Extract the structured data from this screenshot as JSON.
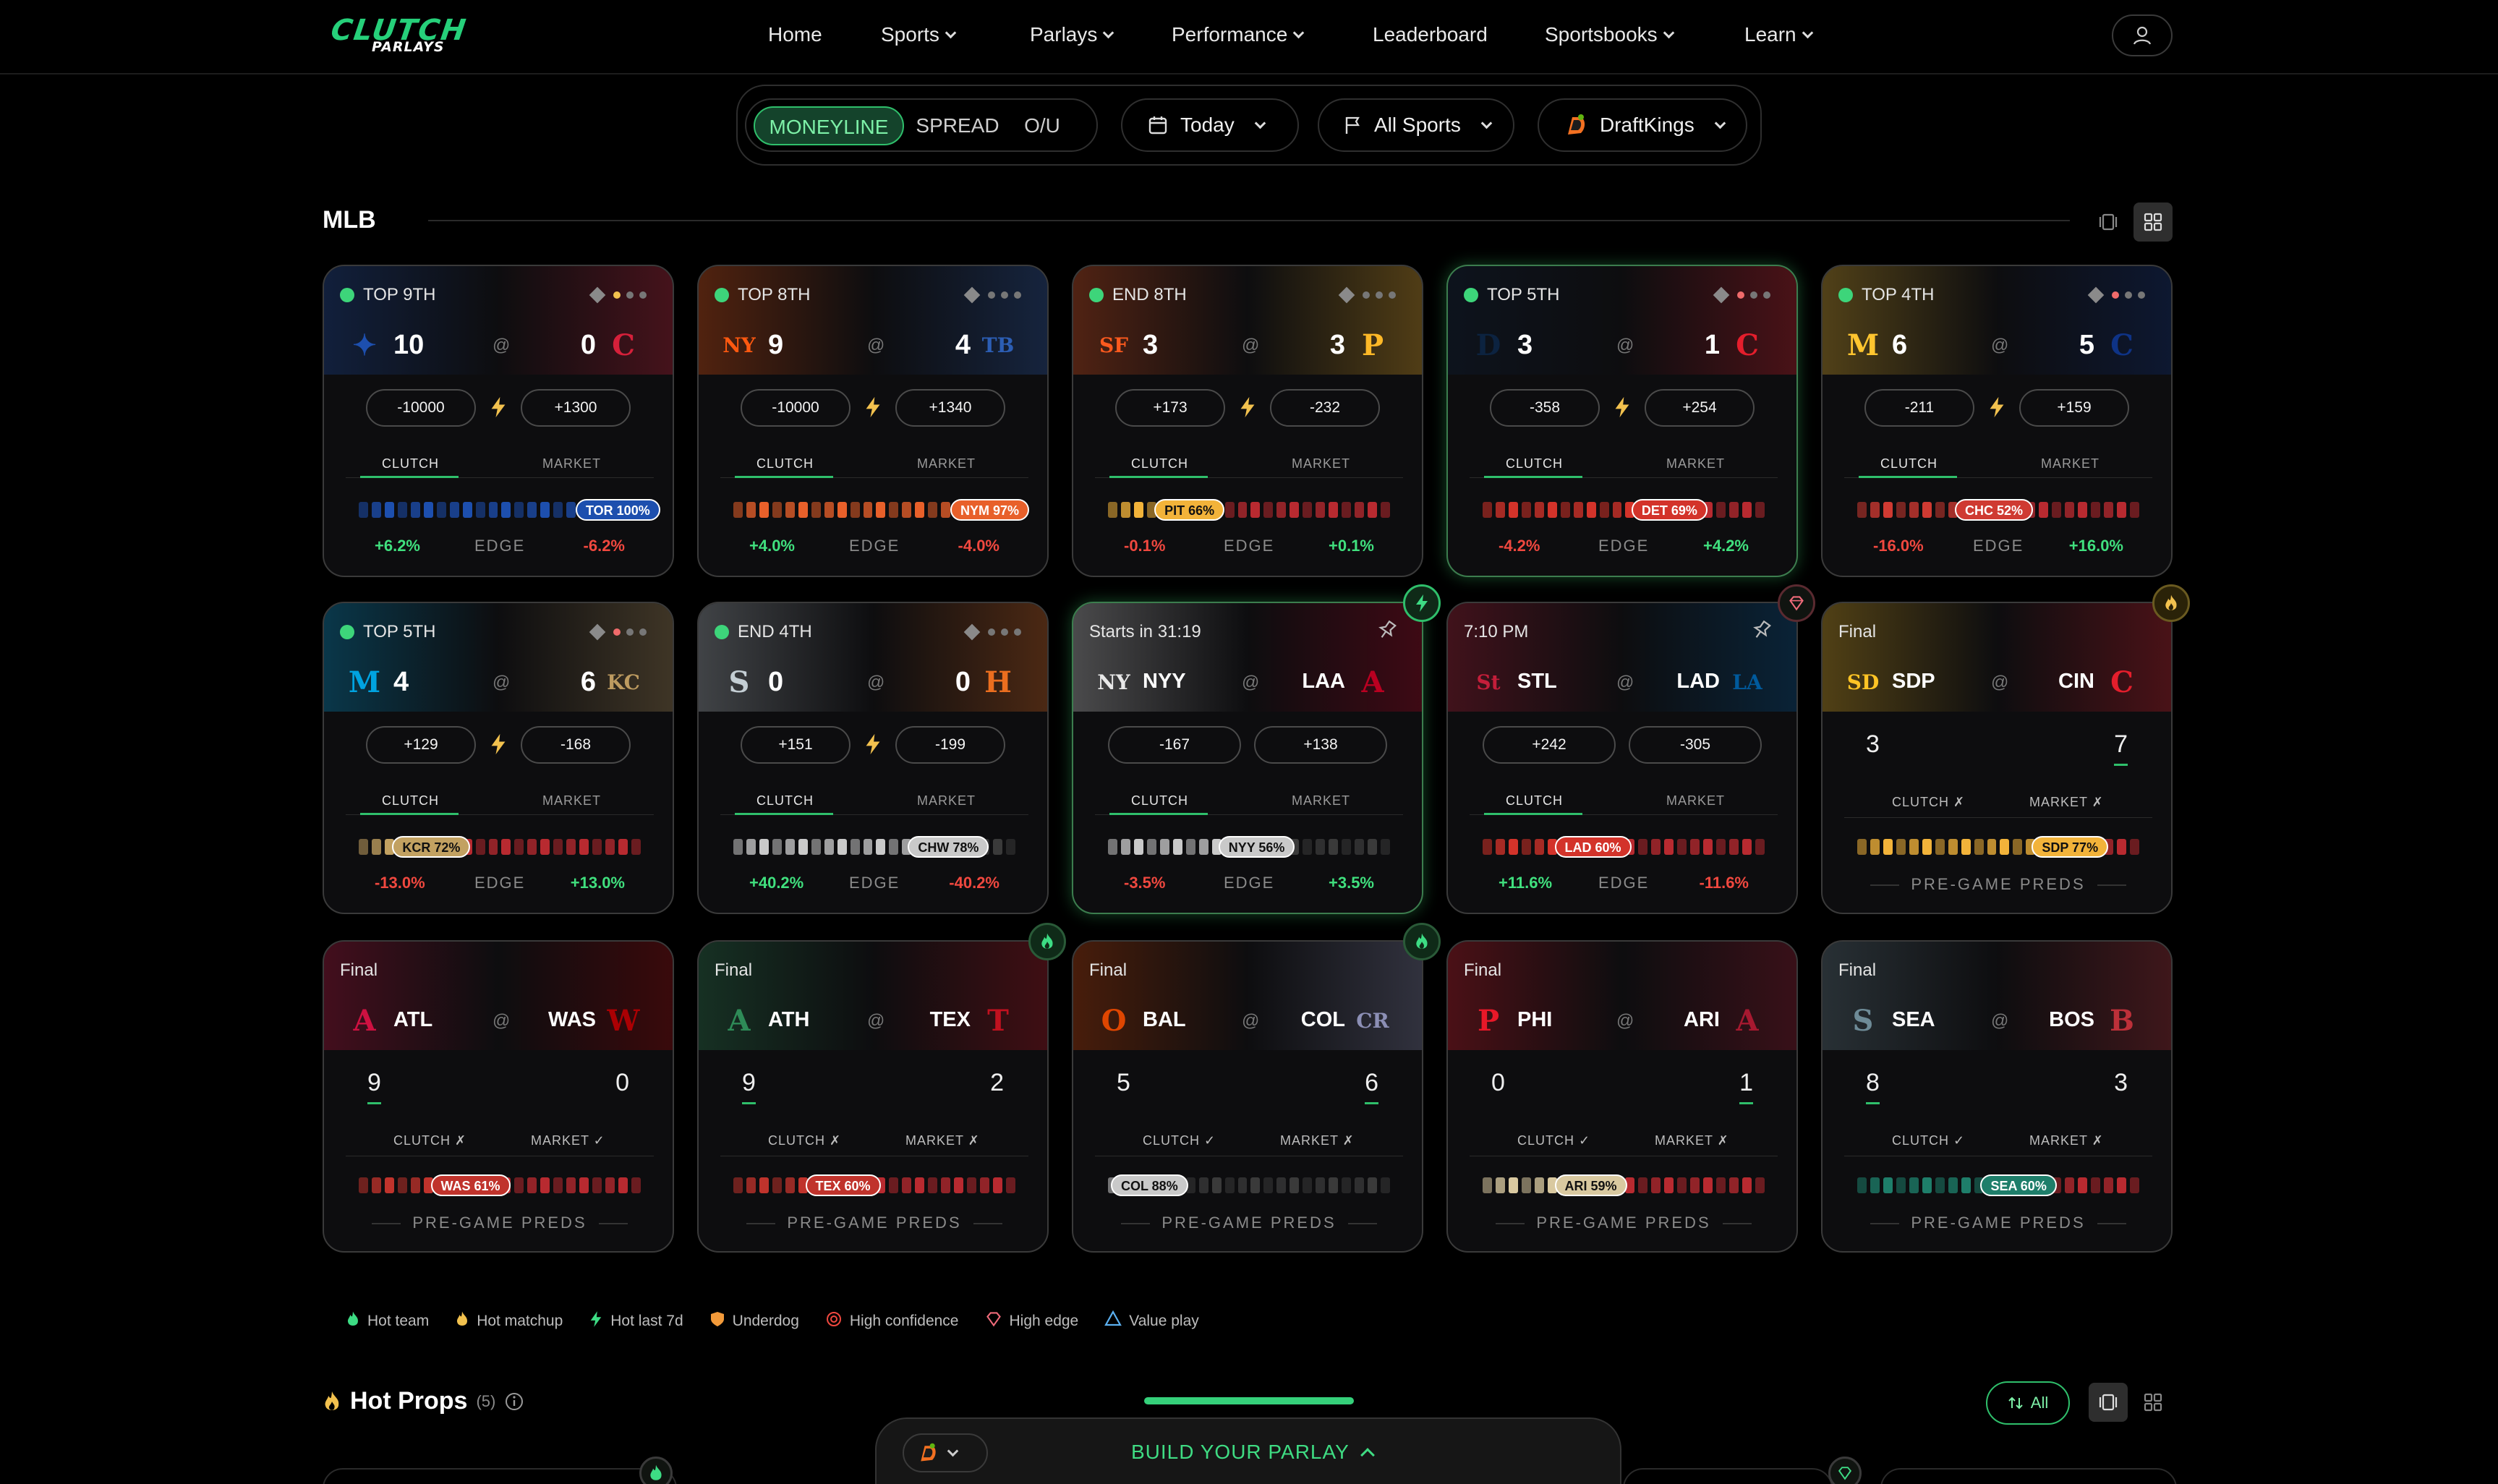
{
  "header": {
    "logo_top": "CLUTCH",
    "logo_bottom": "PARLAYS",
    "nav": [
      {
        "label": "Home",
        "dropdown": false
      },
      {
        "label": "Sports",
        "dropdown": true
      },
      {
        "label": "Parlays",
        "dropdown": true
      },
      {
        "label": "Performance",
        "dropdown": true
      },
      {
        "label": "Leaderboard",
        "dropdown": false
      },
      {
        "label": "Sportsbooks",
        "dropdown": true
      },
      {
        "label": "Learn",
        "dropdown": true
      }
    ]
  },
  "filters": {
    "bet_types": [
      "MONEYLINE",
      "SPREAD",
      "O/U"
    ],
    "active_bet_type": "MONEYLINE",
    "date": "Today",
    "sport": "All Sports",
    "sportsbook": "DraftKings"
  },
  "section": {
    "title": "MLB"
  },
  "colors": {
    "green": "#2fbf6b",
    "positive": "#40e07e",
    "negative": "#f0483f",
    "accent_gold": "#f2c14e"
  },
  "games": [
    {
      "status": "TOP 9TH",
      "live": true,
      "away": {
        "abbr": "TOR",
        "score": "10",
        "color": "#1d4fae"
      },
      "home": {
        "abbr": "CLE",
        "score": "0",
        "color": "#d5203a"
      },
      "show_abbr": false,
      "odds": [
        "-10000",
        "+1300"
      ],
      "tabs": [
        "CLUTCH",
        "MARKET"
      ],
      "badge": "TOR 100%",
      "badge_fill": 1.0,
      "badge_color": "#1d4fae",
      "edge": [
        "+6.2%",
        "EDGE",
        "-6.2%"
      ],
      "dots": [
        "#f2c14e",
        "#777",
        "#777"
      ]
    },
    {
      "status": "TOP 8TH",
      "live": true,
      "away": {
        "abbr": "NYM",
        "score": "9",
        "color": "#ff5910"
      },
      "home": {
        "abbr": "TB",
        "score": "4",
        "color": "#2c5eb4"
      },
      "show_abbr": false,
      "odds": [
        "-10000",
        "+1340"
      ],
      "tabs": [
        "CLUTCH",
        "MARKET"
      ],
      "badge": "NYM 97%",
      "badge_fill": 0.97,
      "badge_color": "#e8602a",
      "edge": [
        "+4.0%",
        "EDGE",
        "-4.0%"
      ],
      "dots": [
        "#777",
        "#777",
        "#777"
      ]
    },
    {
      "status": "END 8TH",
      "live": true,
      "away": {
        "abbr": "SF",
        "score": "3",
        "color": "#fd5a1e"
      },
      "home": {
        "abbr": "PIT",
        "score": "3",
        "color": "#fdb827"
      },
      "show_abbr": false,
      "odds": [
        "+173",
        "-232"
      ],
      "tabs": [
        "CLUTCH",
        "MARKET"
      ],
      "badge": "PIT 66%",
      "badge_fill": 0.34,
      "badge_color": "#f2b33a",
      "edge": [
        "-0.1%",
        "EDGE",
        "+0.1%"
      ],
      "dots": [
        "#777",
        "#777",
        "#777"
      ]
    },
    {
      "status": "TOP 5TH",
      "live": true,
      "away": {
        "abbr": "DET",
        "score": "3",
        "color": "#0c2340"
      },
      "home": {
        "abbr": "CIN",
        "score": "1",
        "color": "#e41e2c"
      },
      "show_abbr": false,
      "odds": [
        "-358",
        "+254"
      ],
      "tabs": [
        "CLUTCH",
        "MARKET"
      ],
      "badge": "DET 69%",
      "badge_fill": 0.69,
      "badge_color": "#d3332a",
      "edge": [
        "-4.2%",
        "EDGE",
        "+4.2%"
      ],
      "dots": [
        "#f06b6b",
        "#777",
        "#777"
      ]
    },
    {
      "status": "TOP 4TH",
      "live": true,
      "away": {
        "abbr": "MIL",
        "score": "6",
        "color": "#ffc52f"
      },
      "home": {
        "abbr": "CHC",
        "score": "5",
        "color": "#0e3386"
      },
      "show_abbr": false,
      "odds": [
        "-211",
        "+159"
      ],
      "tabs": [
        "CLUTCH",
        "MARKET"
      ],
      "badge": "CHC 52%",
      "badge_fill": 0.48,
      "badge_color": "#cf3a32",
      "edge": [
        "-16.0%",
        "EDGE",
        "+16.0%"
      ],
      "dots": [
        "#f06b6b",
        "#777",
        "#777"
      ]
    },
    {
      "status": "TOP 5TH",
      "live": true,
      "away": {
        "abbr": "MIA",
        "score": "4",
        "color": "#00a3e0"
      },
      "home": {
        "abbr": "KC",
        "score": "6",
        "color": "#bd9b60"
      },
      "show_abbr": false,
      "odds": [
        "+129",
        "-168"
      ],
      "tabs": [
        "CLUTCH",
        "MARKET"
      ],
      "badge": "KCR 72%",
      "badge_fill": 0.28,
      "badge_color": "#c2a161",
      "edge": [
        "-13.0%",
        "EDGE",
        "+13.0%"
      ],
      "dots": [
        "#f06b6b",
        "#777",
        "#777"
      ]
    },
    {
      "status": "END 4TH",
      "live": true,
      "away": {
        "abbr": "CHW",
        "score": "0",
        "color": "#c4ced4"
      },
      "home": {
        "abbr": "HOU",
        "score": "0",
        "color": "#eb6e1f"
      },
      "show_abbr": false,
      "odds": [
        "+151",
        "-199"
      ],
      "tabs": [
        "CLUTCH",
        "MARKET"
      ],
      "badge": "CHW 78%",
      "badge_fill": 0.78,
      "badge_color": "#c9c9c9",
      "edge": [
        "+40.2%",
        "EDGE",
        "-40.2%"
      ],
      "dots": [
        "#777",
        "#777",
        "#777"
      ]
    },
    {
      "status": "Starts in 31:19",
      "live": false,
      "away": {
        "abbr": "NYY",
        "score": "",
        "color": "#e8e8e8"
      },
      "home": {
        "abbr": "LAA",
        "score": "",
        "color": "#ba0021"
      },
      "show_abbr": true,
      "odds": [
        "-167",
        "+138"
      ],
      "tabs": [
        "CLUTCH",
        "MARKET"
      ],
      "badge": "NYY 56%",
      "badge_fill": 0.56,
      "badge_color": "#c9c9c9",
      "edge": [
        "-3.5%",
        "EDGE",
        "+3.5%"
      ],
      "pin": true,
      "corner": "bolt"
    },
    {
      "status": "7:10 PM",
      "live": false,
      "away": {
        "abbr": "STL",
        "score": "",
        "color": "#c41e3a"
      },
      "home": {
        "abbr": "LAD",
        "score": "",
        "color": "#005a9c"
      },
      "show_abbr": true,
      "odds": [
        "+242",
        "-305"
      ],
      "tabs": [
        "CLUTCH",
        "MARKET"
      ],
      "badge": "LAD 60%",
      "badge_fill": 0.4,
      "badge_color": "#d3332a",
      "edge": [
        "+11.6%",
        "EDGE",
        "-11.6%"
      ],
      "pin": true,
      "corner": "gem"
    },
    {
      "status": "Final",
      "final": true,
      "away": {
        "abbr": "SDP",
        "score": "3",
        "color": "#ffc425"
      },
      "home": {
        "abbr": "CIN",
        "score": "7",
        "color": "#e41e2c"
      },
      "winner": "home",
      "tabs": [
        "CLUTCH ✗",
        "MARKET ✗"
      ],
      "badge": "SDP 77%",
      "badge_fill": 0.77,
      "badge_color": "#f2b33a",
      "pregame": "PRE-GAME PREDS",
      "corner": "flame"
    },
    {
      "status": "Final",
      "final": true,
      "away": {
        "abbr": "ATL",
        "score": "9",
        "color": "#ce1141"
      },
      "home": {
        "abbr": "WAS",
        "score": "0",
        "color": "#ab0003"
      },
      "winner": "away",
      "tabs": [
        "CLUTCH ✗",
        "MARKET ✓"
      ],
      "badge": "WAS 61%",
      "badge_fill": 0.39,
      "badge_color": "#c0332c",
      "pregame": "PRE-GAME PREDS"
    },
    {
      "status": "Final",
      "final": true,
      "away": {
        "abbr": "ATH",
        "score": "9",
        "color": "#2e8b57"
      },
      "home": {
        "abbr": "TEX",
        "score": "2",
        "color": "#c0111f"
      },
      "winner": "away",
      "tabs": [
        "CLUTCH ✗",
        "MARKET ✗"
      ],
      "badge": "TEX 60%",
      "badge_fill": 0.4,
      "badge_color": "#c0332c",
      "pregame": "PRE-GAME PREDS",
      "corner": "flame-green"
    },
    {
      "status": "Final",
      "final": true,
      "away": {
        "abbr": "BAL",
        "score": "5",
        "color": "#df4601"
      },
      "home": {
        "abbr": "COL",
        "score": "6",
        "color": "#8c8fb5"
      },
      "winner": "home",
      "tabs": [
        "CLUTCH ✓",
        "MARKET ✗"
      ],
      "badge": "COL 88%",
      "badge_fill": 0.12,
      "badge_color": "#c9c9c9",
      "pregame": "PRE-GAME PREDS",
      "corner": "flame-green"
    },
    {
      "status": "Final",
      "final": true,
      "away": {
        "abbr": "PHI",
        "score": "0",
        "color": "#e81828"
      },
      "home": {
        "abbr": "ARI",
        "score": "1",
        "color": "#a71930"
      },
      "winner": "home",
      "tabs": [
        "CLUTCH ✓",
        "MARKET ✗"
      ],
      "badge": "ARI 59%",
      "badge_fill": 0.41,
      "badge_color": "#d9c9a0",
      "pregame": "PRE-GAME PREDS"
    },
    {
      "status": "Final",
      "final": true,
      "away": {
        "abbr": "SEA",
        "score": "8",
        "color": "#6e8b97"
      },
      "home": {
        "abbr": "BOS",
        "score": "3",
        "color": "#bd3039"
      },
      "winner": "away",
      "tabs": [
        "CLUTCH ✓",
        "MARKET ✗"
      ],
      "badge": "SEA 60%",
      "badge_fill": 0.6,
      "badge_color": "#1e7e6a",
      "pregame": "PRE-GAME PREDS"
    }
  ],
  "legend": [
    {
      "label": "Hot team",
      "icon": "flame-green-icon",
      "color": "#3ddc84"
    },
    {
      "label": "Hot matchup",
      "icon": "flame-gold-icon",
      "color": "#f2c14e"
    },
    {
      "label": "Hot last 7d",
      "icon": "bolt-icon",
      "color": "#3ddc84"
    },
    {
      "label": "Underdog",
      "icon": "shield-icon",
      "color": "#f29a3a"
    },
    {
      "label": "High confidence",
      "icon": "target-icon",
      "color": "#f0483f"
    },
    {
      "label": "High edge",
      "icon": "gem-icon",
      "color": "#f06b7a"
    },
    {
      "label": "Value play",
      "icon": "diamond-icon",
      "color": "#5bb0f0"
    }
  ],
  "hot_props": {
    "title": "Hot Props",
    "count": "(5)",
    "filter_label": "All"
  },
  "build_parlay": {
    "label": "BUILD YOUR PARLAY"
  }
}
